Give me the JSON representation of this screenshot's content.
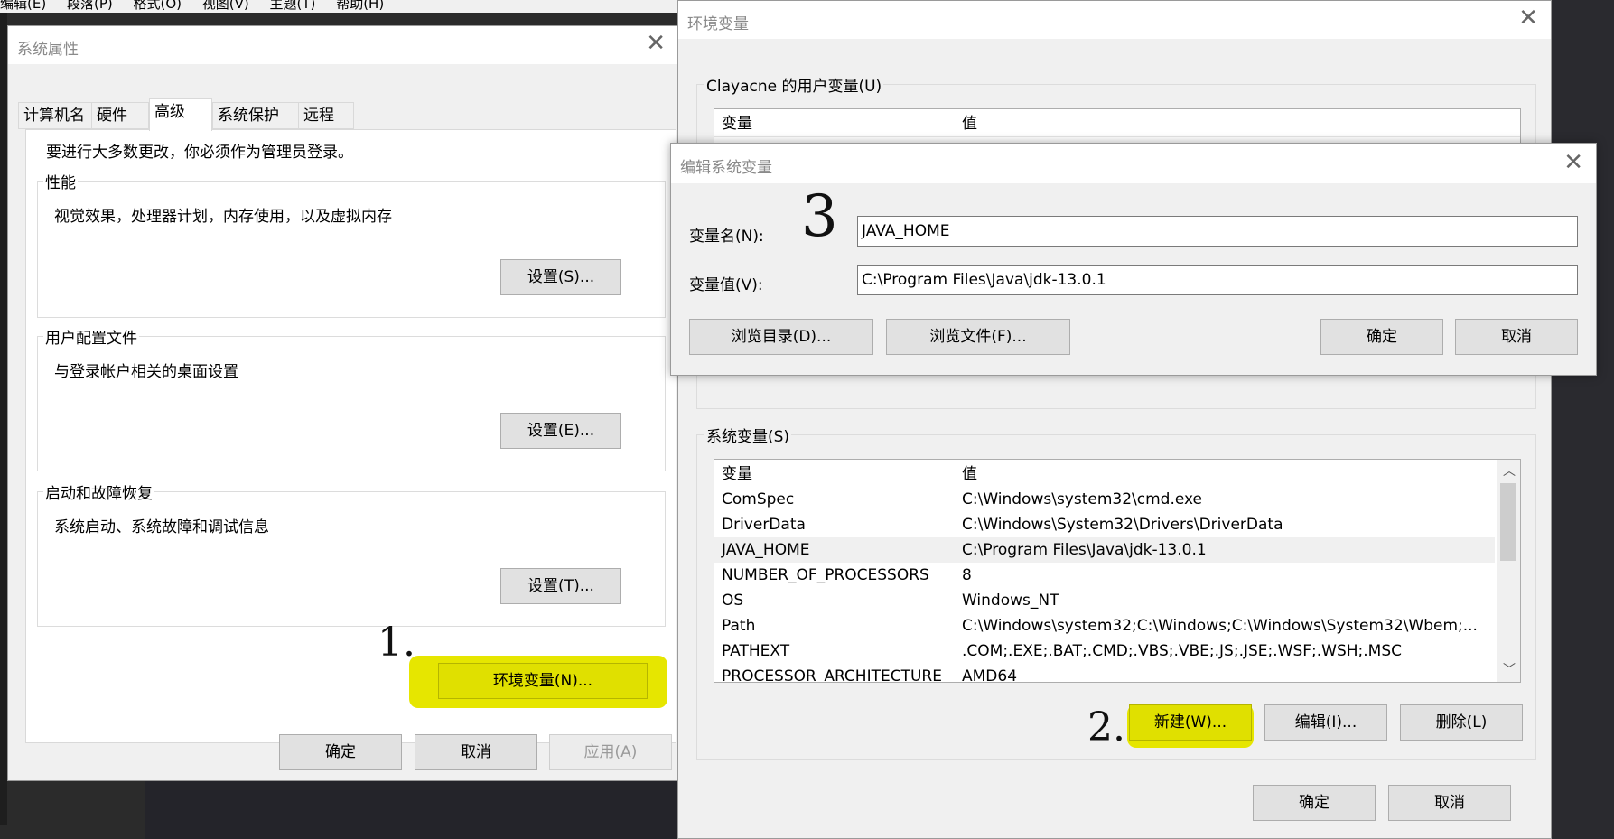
{
  "menu": {
    "items": [
      "编辑(E)",
      "段落(P)",
      "格式(O)",
      "视图(V)",
      "主题(T)",
      "帮助(H)"
    ]
  },
  "sysprops": {
    "title": "系统属性",
    "tabs": [
      "计算机名",
      "硬件",
      "高级",
      "系统保护",
      "远程"
    ],
    "notice": "要进行大多数更改，你必须作为管理员登录。",
    "perf": {
      "label": "性能",
      "desc": "视觉效果，处理器计划，内存使用，以及虚拟内存",
      "button": "设置(S)..."
    },
    "profile": {
      "label": "用户配置文件",
      "desc": "与登录帐户相关的桌面设置",
      "button": "设置(E)..."
    },
    "startup": {
      "label": "启动和故障恢复",
      "desc": "系统启动、系统故障和调试信息",
      "button": "设置(T)..."
    },
    "env_button": "环境变量(N)...",
    "ok": "确定",
    "cancel": "取消",
    "apply": "应用(A)"
  },
  "envvars": {
    "title": "环境变量",
    "user_group": "Clayacne 的用户变量(U)",
    "col_var": "变量",
    "col_val": "值",
    "sys_group": "系统变量(S)",
    "sys_rows": [
      {
        "name": "ComSpec",
        "value": "C:\\Windows\\system32\\cmd.exe"
      },
      {
        "name": "DriverData",
        "value": "C:\\Windows\\System32\\Drivers\\DriverData"
      },
      {
        "name": "JAVA_HOME",
        "value": "C:\\Program Files\\Java\\jdk-13.0.1"
      },
      {
        "name": "NUMBER_OF_PROCESSORS",
        "value": "8"
      },
      {
        "name": "OS",
        "value": "Windows_NT"
      },
      {
        "name": "Path",
        "value": "C:\\Windows\\system32;C:\\Windows;C:\\Windows\\System32\\Wbem;..."
      },
      {
        "name": "PATHEXT",
        "value": ".COM;.EXE;.BAT;.CMD;.VBS;.VBE;.JS;.JSE;.WSF;.WSH;.MSC"
      },
      {
        "name": "PROCESSOR_ARCHITECTURE",
        "value": "AMD64"
      }
    ],
    "new_btn": "新建(W)...",
    "edit_btn": "编辑(I)...",
    "delete_btn": "删除(L)",
    "ok": "确定",
    "cancel": "取消"
  },
  "editvar": {
    "title": "编辑系统变量",
    "name_label": "变量名(N):",
    "name_value": "JAVA_HOME",
    "value_label": "变量值(V):",
    "value_value": "C:\\Program Files\\Java\\jdk-13.0.1",
    "browse_dir": "浏览目录(D)...",
    "browse_file": "浏览文件(F)...",
    "ok": "确定",
    "cancel": "取消"
  },
  "annotations": {
    "step1": "1.",
    "step2": "2.",
    "step3": "3",
    "highlight_color": "#e6e600"
  }
}
